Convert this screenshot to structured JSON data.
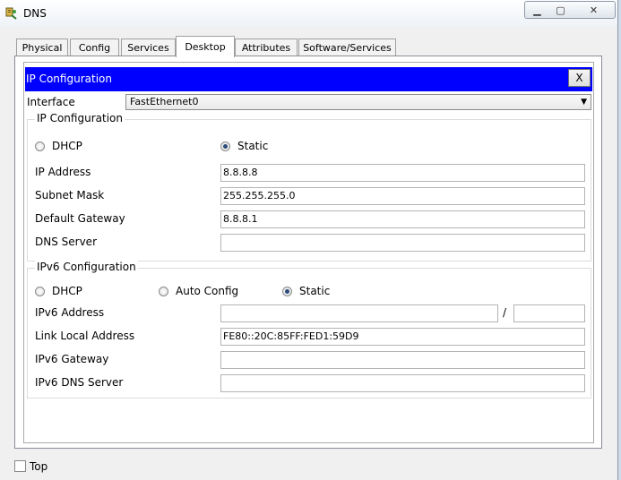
{
  "window": {
    "title": "DNS",
    "icon": "packet-tracer-server-icon",
    "controls": {
      "minimize": "▁",
      "maximize": "▢",
      "close": "✕"
    }
  },
  "tabs": [
    {
      "label": "Physical",
      "active": false
    },
    {
      "label": "Config",
      "active": false
    },
    {
      "label": "Services",
      "active": false
    },
    {
      "label": "Desktop",
      "active": true
    },
    {
      "label": "Attributes",
      "active": false
    },
    {
      "label": "Software/Services",
      "active": false
    }
  ],
  "panel": {
    "title": "IP Configuration",
    "close_label": "X",
    "header_color": "#0000ff"
  },
  "interface": {
    "label": "Interface",
    "value": "FastEthernet0",
    "arrow": "▼"
  },
  "ipv4": {
    "group_label": "IP Configuration",
    "dhcp_label": "DHCP",
    "static_label": "Static",
    "selected": "Static",
    "ip_address_label": "IP Address",
    "ip_address_value": "8.8.8.8",
    "subnet_mask_label": "Subnet Mask",
    "subnet_mask_value": "255.255.255.0",
    "gateway_label": "Default Gateway",
    "gateway_value": "8.8.8.1",
    "dns_server_label": "DNS Server",
    "dns_server_value": ""
  },
  "ipv6": {
    "group_label": "IPv6 Configuration",
    "dhcp_label": "DHCP",
    "auto_config_label": "Auto Config",
    "static_label": "Static",
    "selected": "Static",
    "address_label": "IPv6 Address",
    "address_value": "",
    "slash": "/",
    "prefix_value": "",
    "link_local_label": "Link Local Address",
    "link_local_value": "FE80::20C:85FF:FED1:59D9",
    "gateway_label": "IPv6 Gateway",
    "gateway_value": "",
    "dns_label": "IPv6 DNS Server",
    "dns_value": ""
  },
  "footer": {
    "top_label": "Top",
    "top_checked": false
  }
}
